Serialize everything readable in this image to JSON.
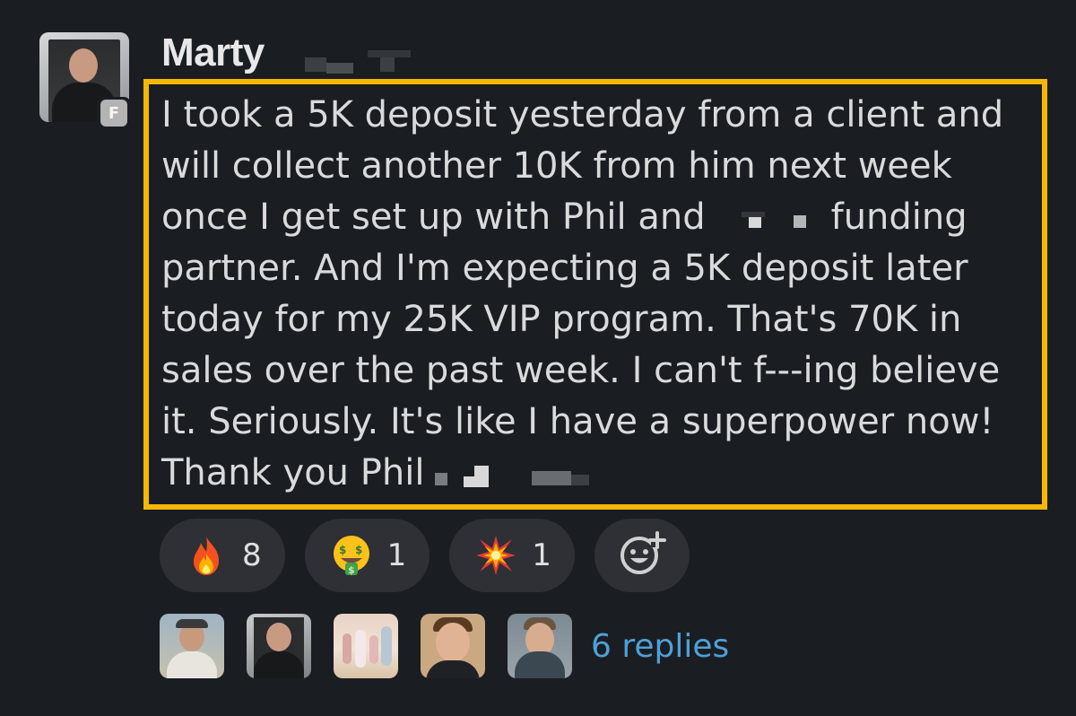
{
  "message": {
    "sender_name": "Marty",
    "badge_letter": "F",
    "lines": [
      "I took a 5K deposit yesterday from a client and",
      "will collect another 10K from him next week",
      "once I get set up with Phil and",
      "funding",
      "partner. And I'm expecting a 5K deposit later",
      "today for my 25K VIP program. That's 70K in",
      "sales over the past week. I can't f---ing believe",
      "it. Seriously. It's like I have a superpower now!",
      "Thank you Phil"
    ],
    "highlight_color": "#f6b704"
  },
  "reactions": [
    {
      "emoji": "fire-emoji",
      "count": "8"
    },
    {
      "emoji": "money-mouth-face-emoji",
      "count": "1"
    },
    {
      "emoji": "collision-emoji",
      "count": "1"
    }
  ],
  "add_reaction_icon": "add-emoji-icon",
  "thread": {
    "replies_label": "6 replies",
    "link_color": "#4ea0d8"
  }
}
